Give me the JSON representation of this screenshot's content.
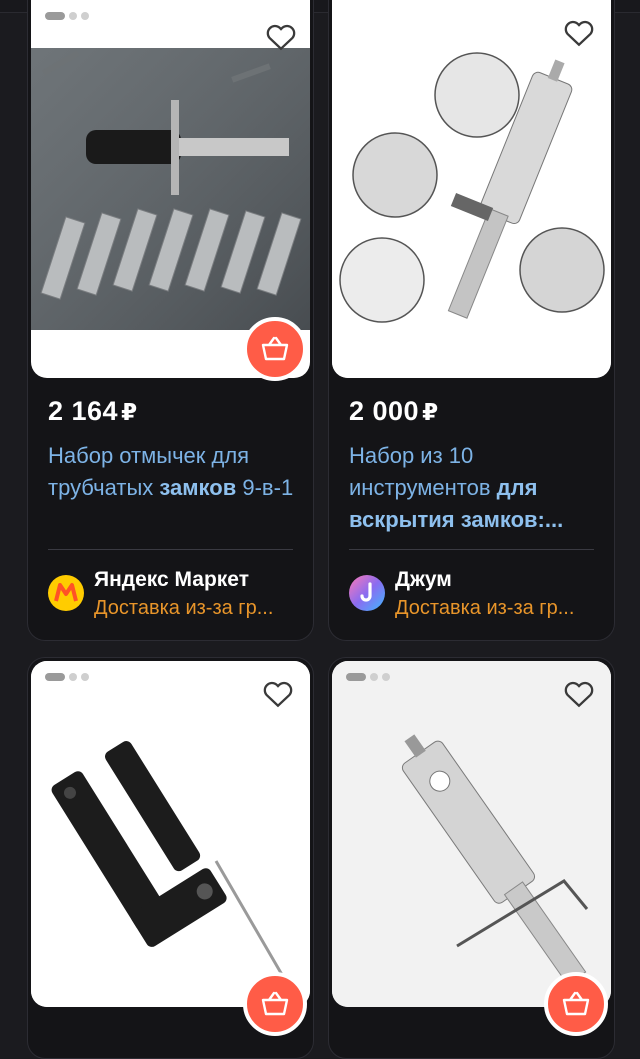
{
  "products": [
    {
      "price": "2 164",
      "currency": "₽",
      "title_plain": "Набор отмычек для трубчатых ",
      "title_bold": "замков",
      "title_tail": " 9-в-1",
      "seller": "Яндекс Маркет",
      "delivery": "Доставка из-за гр...",
      "seller_logo_color": "#ffcc00"
    },
    {
      "price": "2 000",
      "currency": "₽",
      "title_plain": "Набор из 10 инструментов ",
      "title_bold": "для вскрытия замков",
      "title_tail": ":...",
      "seller": "Джум",
      "delivery": "Доставка из-за гр...",
      "seller_logo_color": "#8b6cf0"
    },
    {},
    {}
  ],
  "colors": {
    "background": "#1b1b1f",
    "card": "#141417",
    "price": "#ffffff",
    "title": "#7db3e6",
    "delivery": "#e8952a",
    "cart_button": "#ff5c47"
  },
  "icons": [
    "heart-outline-icon",
    "shopping-basket-icon"
  ]
}
